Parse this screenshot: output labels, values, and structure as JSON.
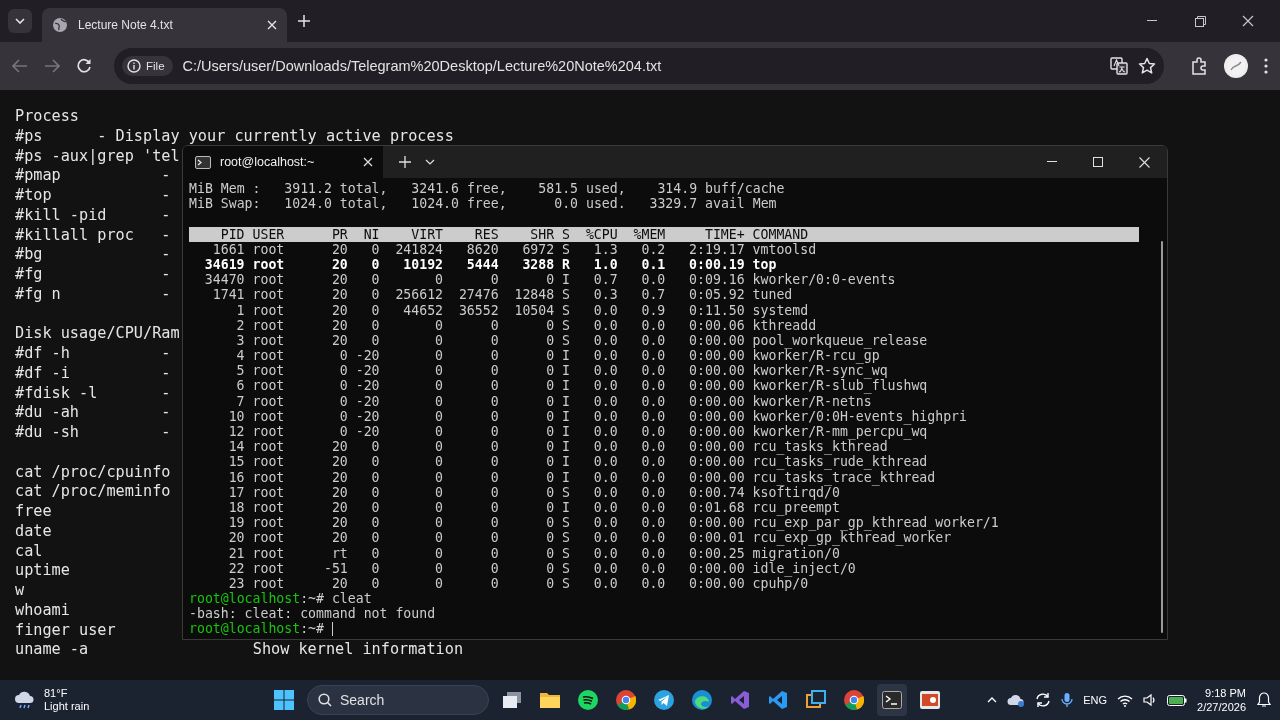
{
  "browser": {
    "tab": {
      "title": "Lecture Note 4.txt",
      "selected": true
    },
    "address": {
      "chip": "File",
      "url": "C:/Users/user/Downloads/Telegram%20Desktop/Lecture%20Note%204.txt"
    }
  },
  "document": {
    "lines": [
      {
        "text": "Process"
      },
      {
        "text": "#ps      - Display your currently active process"
      },
      {
        "text": "#ps -aux|grep 'tel"
      },
      {
        "text": "#pmap           -"
      },
      {
        "text": "#top            -"
      },
      {
        "text": "#kill -pid      -"
      },
      {
        "text": "#killall proc   -"
      },
      {
        "text": "#bg             -"
      },
      {
        "text": "#fg             -"
      },
      {
        "text": "#fg n           -"
      },
      {
        "gap_before": true,
        "text": "Disk usage/CPU/Ram"
      },
      {
        "text": "#df -h          -"
      },
      {
        "text": "#df -i          -"
      },
      {
        "text": "#fdisk -l       -"
      },
      {
        "text": "#du -ah         -"
      },
      {
        "text": "#du -sh         -"
      },
      {
        "gap_before": true,
        "text": "cat /proc/cpuinfo"
      },
      {
        "text": "cat /proc/meminfo"
      },
      {
        "text": "free"
      },
      {
        "text": "date"
      },
      {
        "text": "cal"
      },
      {
        "text": "uptime"
      },
      {
        "text": "w"
      },
      {
        "text": "whoami"
      },
      {
        "text": "finger user"
      },
      {
        "text": "uname -a",
        "desc": "Show kernel information"
      }
    ]
  },
  "terminal": {
    "tab_title": "root@localhost:~",
    "summary": [
      "MiB Mem :   3911.2 total,   3241.6 free,    581.5 used,    314.9 buff/cache",
      "MiB Swap:   1024.0 total,   1024.0 free,      0.0 used.   3329.7 avail Mem"
    ],
    "columns": [
      "PID",
      "USER",
      "PR",
      "NI",
      "VIRT",
      "RES",
      "SHR",
      "S",
      "%CPU",
      "%MEM",
      "TIME+",
      "COMMAND"
    ],
    "rows": [
      {
        "highlighted": false,
        "cells": [
          "1661",
          "root",
          "20",
          "0",
          "241824",
          "8620",
          "6972",
          "S",
          "1.3",
          "0.2",
          "2:19.17",
          "vmtoolsd"
        ]
      },
      {
        "highlighted": true,
        "cells": [
          "34619",
          "root",
          "20",
          "0",
          "10192",
          "5444",
          "3288",
          "R",
          "1.0",
          "0.1",
          "0:00.19",
          "top"
        ]
      },
      {
        "highlighted": false,
        "cells": [
          "34470",
          "root",
          "20",
          "0",
          "0",
          "0",
          "0",
          "I",
          "0.7",
          "0.0",
          "0:09.16",
          "kworker/0:0-events"
        ]
      },
      {
        "highlighted": false,
        "cells": [
          "1741",
          "root",
          "20",
          "0",
          "256612",
          "27476",
          "12848",
          "S",
          "0.3",
          "0.7",
          "0:05.92",
          "tuned"
        ]
      },
      {
        "highlighted": false,
        "cells": [
          "1",
          "root",
          "20",
          "0",
          "44652",
          "36552",
          "10504",
          "S",
          "0.0",
          "0.9",
          "0:11.50",
          "systemd"
        ]
      },
      {
        "highlighted": false,
        "cells": [
          "2",
          "root",
          "20",
          "0",
          "0",
          "0",
          "0",
          "S",
          "0.0",
          "0.0",
          "0:00.06",
          "kthreadd"
        ]
      },
      {
        "highlighted": false,
        "cells": [
          "3",
          "root",
          "20",
          "0",
          "0",
          "0",
          "0",
          "S",
          "0.0",
          "0.0",
          "0:00.00",
          "pool_workqueue_release"
        ]
      },
      {
        "highlighted": false,
        "cells": [
          "4",
          "root",
          "0",
          "-20",
          "0",
          "0",
          "0",
          "I",
          "0.0",
          "0.0",
          "0:00.00",
          "kworker/R-rcu_gp"
        ]
      },
      {
        "highlighted": false,
        "cells": [
          "5",
          "root",
          "0",
          "-20",
          "0",
          "0",
          "0",
          "I",
          "0.0",
          "0.0",
          "0:00.00",
          "kworker/R-sync_wq"
        ]
      },
      {
        "highlighted": false,
        "cells": [
          "6",
          "root",
          "0",
          "-20",
          "0",
          "0",
          "0",
          "I",
          "0.0",
          "0.0",
          "0:00.00",
          "kworker/R-slub_flushwq"
        ]
      },
      {
        "highlighted": false,
        "cells": [
          "7",
          "root",
          "0",
          "-20",
          "0",
          "0",
          "0",
          "I",
          "0.0",
          "0.0",
          "0:00.00",
          "kworker/R-netns"
        ]
      },
      {
        "highlighted": false,
        "cells": [
          "10",
          "root",
          "0",
          "-20",
          "0",
          "0",
          "0",
          "I",
          "0.0",
          "0.0",
          "0:00.00",
          "kworker/0:0H-events_highpri"
        ]
      },
      {
        "highlighted": false,
        "cells": [
          "12",
          "root",
          "0",
          "-20",
          "0",
          "0",
          "0",
          "I",
          "0.0",
          "0.0",
          "0:00.00",
          "kworker/R-mm_percpu_wq"
        ]
      },
      {
        "highlighted": false,
        "cells": [
          "14",
          "root",
          "20",
          "0",
          "0",
          "0",
          "0",
          "I",
          "0.0",
          "0.0",
          "0:00.00",
          "rcu_tasks_kthread"
        ]
      },
      {
        "highlighted": false,
        "cells": [
          "15",
          "root",
          "20",
          "0",
          "0",
          "0",
          "0",
          "I",
          "0.0",
          "0.0",
          "0:00.00",
          "rcu_tasks_rude_kthread"
        ]
      },
      {
        "highlighted": false,
        "cells": [
          "16",
          "root",
          "20",
          "0",
          "0",
          "0",
          "0",
          "I",
          "0.0",
          "0.0",
          "0:00.00",
          "rcu_tasks_trace_kthread"
        ]
      },
      {
        "highlighted": false,
        "cells": [
          "17",
          "root",
          "20",
          "0",
          "0",
          "0",
          "0",
          "S",
          "0.0",
          "0.0",
          "0:00.74",
          "ksoftirqd/0"
        ]
      },
      {
        "highlighted": false,
        "cells": [
          "18",
          "root",
          "20",
          "0",
          "0",
          "0",
          "0",
          "I",
          "0.0",
          "0.0",
          "0:01.68",
          "rcu_preempt"
        ]
      },
      {
        "highlighted": false,
        "cells": [
          "19",
          "root",
          "20",
          "0",
          "0",
          "0",
          "0",
          "S",
          "0.0",
          "0.0",
          "0:00.00",
          "rcu_exp_par_gp_kthread_worker/1"
        ]
      },
      {
        "highlighted": false,
        "cells": [
          "20",
          "root",
          "20",
          "0",
          "0",
          "0",
          "0",
          "S",
          "0.0",
          "0.0",
          "0:00.01",
          "rcu_exp_gp_kthread_worker"
        ]
      },
      {
        "highlighted": false,
        "cells": [
          "21",
          "root",
          "rt",
          "0",
          "0",
          "0",
          "0",
          "S",
          "0.0",
          "0.0",
          "0:00.25",
          "migration/0"
        ]
      },
      {
        "highlighted": false,
        "cells": [
          "22",
          "root",
          "-51",
          "0",
          "0",
          "0",
          "0",
          "S",
          "0.0",
          "0.0",
          "0:00.00",
          "idle_inject/0"
        ]
      },
      {
        "highlighted": false,
        "cells": [
          "23",
          "root",
          "20",
          "0",
          "0",
          "0",
          "0",
          "S",
          "0.0",
          "0.0",
          "0:00.00",
          "cpuhp/0"
        ]
      }
    ],
    "session": [
      {
        "kind": "prompt",
        "user_host": "root@localhost",
        "path": ":~#",
        "command": "cleat",
        "cursor": false
      },
      {
        "kind": "output",
        "text": "-bash: cleat: command not found"
      },
      {
        "kind": "prompt",
        "user_host": "root@localhost",
        "path": ":~#",
        "cursor": true
      }
    ]
  },
  "taskbar": {
    "weather": {
      "temperature": "81°F",
      "condition": "Light rain"
    },
    "search": {
      "placeholder": "Search"
    },
    "language": "ENG",
    "time": "9:18 PM",
    "date": "2/27/2026"
  }
}
